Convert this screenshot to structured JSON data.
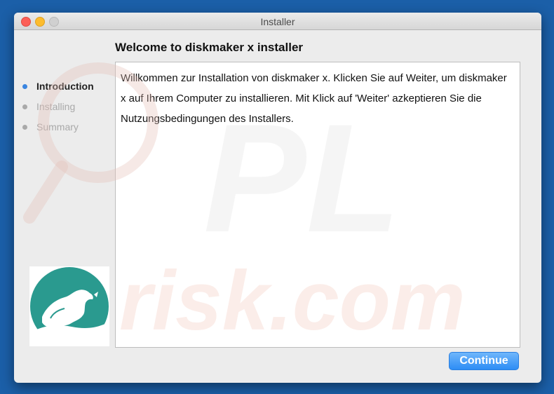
{
  "window": {
    "title": "Installer"
  },
  "main": {
    "heading": "Welcome to diskmaker x installer",
    "body": "Willkommen zur Installation von diskmaker x. Klicken Sie auf Weiter, um diskmaker x auf Ihrem Computer zu installieren. Mit Klick auf 'Weiter' azkeptieren Sie die Nutzungsbedingungen des Installers."
  },
  "sidebar": {
    "steps": [
      {
        "label": "Introduction",
        "active": true
      },
      {
        "label": "Installing",
        "active": false
      },
      {
        "label": "Summary",
        "active": false
      }
    ]
  },
  "buttons": {
    "continue_label": "Continue"
  },
  "watermark": {
    "text": "risk.com"
  },
  "colors": {
    "desktop": "#1b5fa8",
    "window_bg": "#ececec",
    "active_step": "#3a85e0",
    "continue_button": "#3a96f7",
    "logo_teal": "#2a9a8f"
  },
  "icons": [
    "close-icon",
    "minimize-icon",
    "zoom-icon",
    "diskmaker-logo"
  ]
}
